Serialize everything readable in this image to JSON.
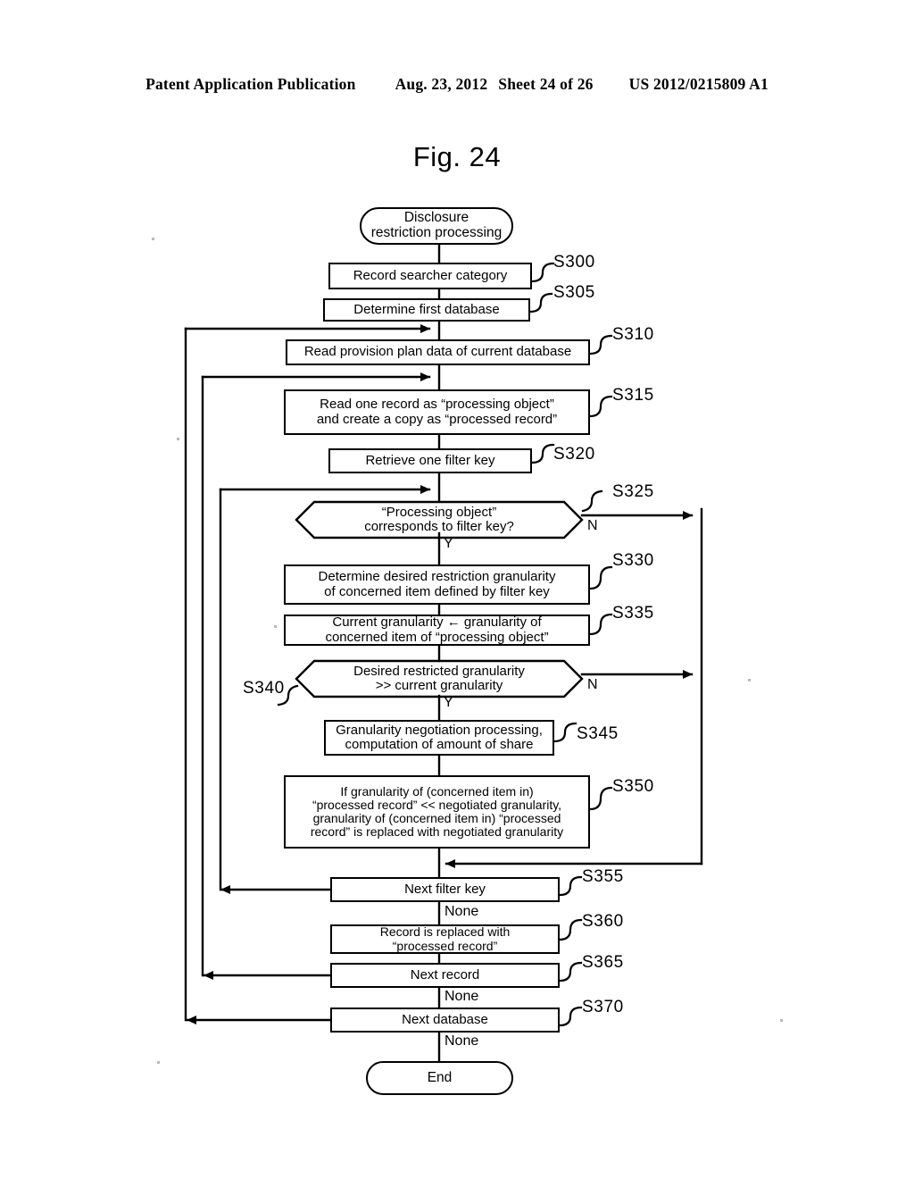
{
  "header": {
    "publication": "Patent Application Publication",
    "date": "Aug. 23, 2012",
    "sheet": "Sheet 24 of 26",
    "patent_number": "US 2012/0215809 A1"
  },
  "figure": {
    "title": "Fig. 24"
  },
  "flowchart": {
    "start": {
      "line1": "Disclosure",
      "line2": "restriction processing"
    },
    "end": {
      "label": "End"
    },
    "steps": [
      {
        "id": "S300",
        "label": "S300",
        "text": "Record searcher category"
      },
      {
        "id": "S305",
        "label": "S305",
        "text": "Determine first database"
      },
      {
        "id": "S310",
        "label": "S310",
        "text": "Read provision plan data of current database"
      },
      {
        "id": "S315",
        "label": "S315",
        "line1": "Read one record as “processing object”",
        "line2": "and create a copy as “processed record”"
      },
      {
        "id": "S320",
        "label": "S320",
        "text": "Retrieve one filter key"
      },
      {
        "id": "S325",
        "label": "S325",
        "line1": "“Processing object”",
        "line2": "corresponds to filter key?"
      },
      {
        "id": "S330",
        "label": "S330",
        "line1": "Determine desired restriction granularity",
        "line2": "of concerned item defined by filter key"
      },
      {
        "id": "S335",
        "label": "S335",
        "line1": "Current granularity ← granularity of",
        "line2": "concerned item of “processing object”"
      },
      {
        "id": "S340",
        "label": "S340",
        "line1": "Desired restricted granularity",
        "line2": ">> current granularity"
      },
      {
        "id": "S345",
        "label": "S345",
        "line1": "Granularity negotiation processing,",
        "line2": "computation of amount of share"
      },
      {
        "id": "S350",
        "label": "S350",
        "line1": "If granularity of (concerned item in)",
        "line2": "“processed record” << negotiated granularity,",
        "line3": "granularity of (concerned item in) “processed",
        "line4": "record” is replaced with negotiated granularity"
      },
      {
        "id": "S355",
        "label": "S355",
        "text": "Next filter key"
      },
      {
        "id": "S360",
        "label": "S360",
        "line1": "Record is replaced with",
        "line2": "“processed record”"
      },
      {
        "id": "S365",
        "label": "S365",
        "text": "Next record"
      },
      {
        "id": "S370",
        "label": "S370",
        "text": "Next database"
      }
    ],
    "edge_labels": {
      "yes_s325": "Y",
      "no_s325": "N",
      "yes_s340": "Y",
      "no_s340": "N",
      "none_s355": "None",
      "none_s365": "None",
      "none_s370": "None"
    }
  }
}
